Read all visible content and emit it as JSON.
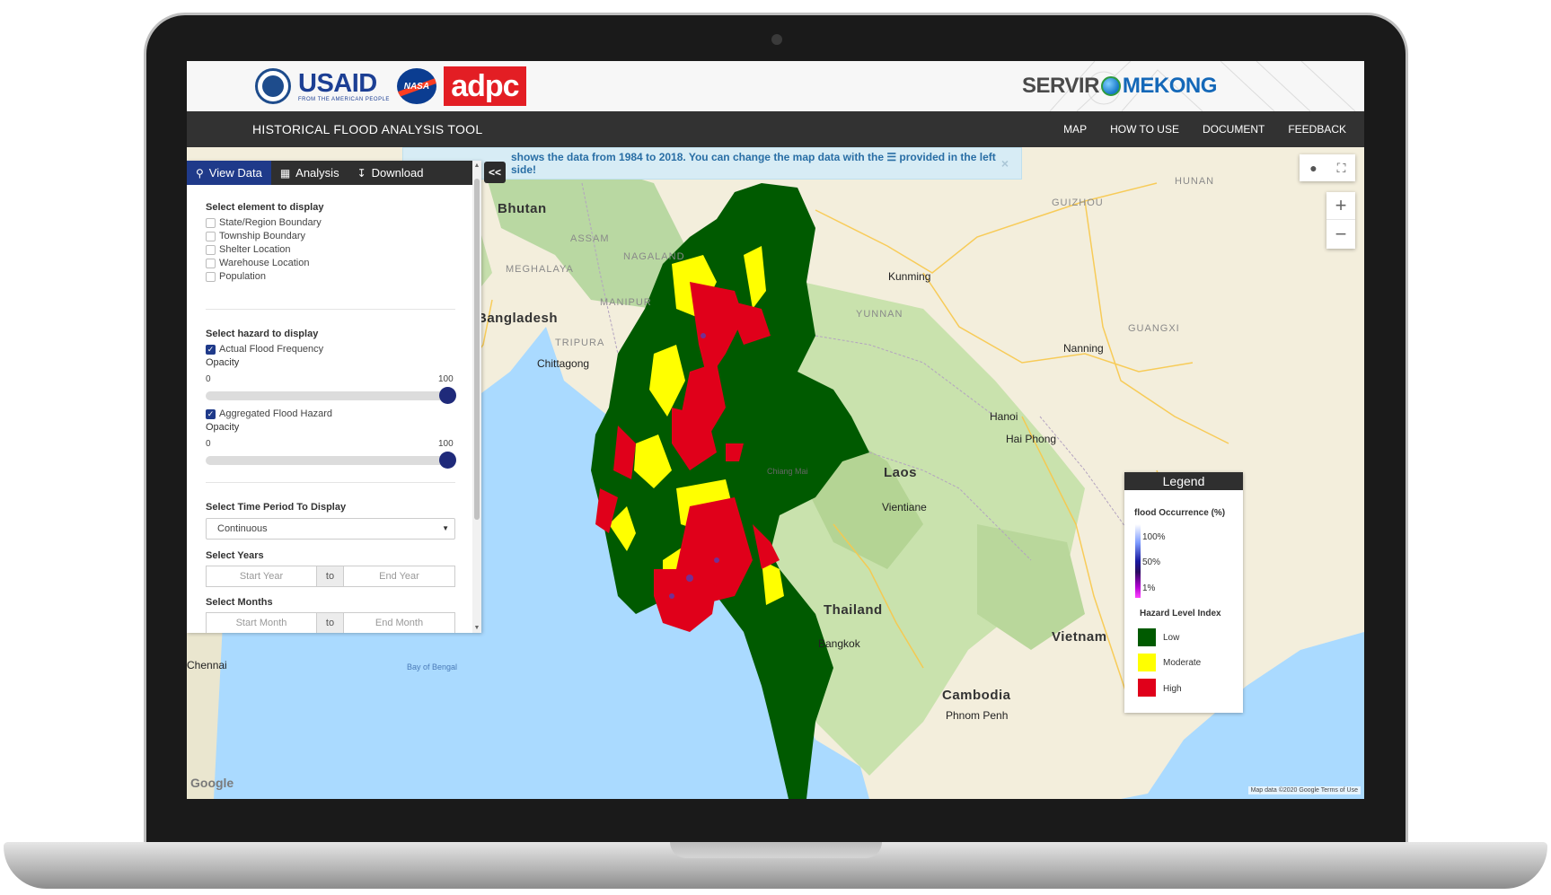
{
  "header": {
    "usaid_word": "USAID",
    "usaid_sub": "FROM THE AMERICAN PEOPLE",
    "nasa_word": "NASA",
    "adpc_word": "adpc",
    "servir_a": "SERVIR",
    "servir_b": "MEKONG"
  },
  "nav": {
    "title": "HISTORICAL FLOOD ANALYSIS TOOL",
    "links": [
      "MAP",
      "HOW TO USE",
      "DOCUMENT",
      "FEEDBACK"
    ]
  },
  "banner": {
    "text": "shows the data from 1984 to 2018. You can change the map data with the ☰ provided in the left side!",
    "close": "×"
  },
  "collapse_label": "<<",
  "panel": {
    "tabs": [
      {
        "icon": "search-icon",
        "label": "View Data",
        "active": true
      },
      {
        "icon": "map-icon",
        "label": "Analysis",
        "active": false
      },
      {
        "icon": "download-icon",
        "label": "Download",
        "active": false
      }
    ],
    "elements_title": "Select element to display",
    "elements": [
      "State/Region Boundary",
      "Township Boundary",
      "Shelter Location",
      "Warehouse Location",
      "Population"
    ],
    "hazard_title": "Select hazard to display",
    "hazards": [
      {
        "label": "Actual Flood Frequency",
        "checked": true,
        "opacity_label": "Opacity",
        "min": "0",
        "max": "100",
        "value": 100
      },
      {
        "label": "Aggregated Flood Hazard",
        "checked": true,
        "opacity_label": "Opacity",
        "min": "0",
        "max": "100",
        "value": 100
      }
    ],
    "period_title": "Select Time Period To Display",
    "period_value": "Continuous",
    "years_title": "Select Years",
    "start_year_placeholder": "Start Year",
    "to_label": "to",
    "end_year_placeholder": "End Year",
    "months_title": "Select Months",
    "start_month_placeholder": "Start Month",
    "end_month_placeholder": "End Month"
  },
  "legend": {
    "title": "Legend",
    "occurrence_title": "flood Occurrence (%)",
    "ramp_labels": [
      "100%",
      "50%",
      "1%"
    ],
    "hazard_title": "Hazard Level Index",
    "levels": [
      {
        "label": "Low",
        "color": "#005a00"
      },
      {
        "label": "Moderate",
        "color": "#ffff00"
      },
      {
        "label": "High",
        "color": "#e0001a"
      }
    ]
  },
  "map": {
    "countries": [
      "Bhutan",
      "Bangladesh",
      "Laos",
      "Thailand",
      "Cambodia",
      "Vietnam"
    ],
    "cities": [
      "Chittagong",
      "Kunming",
      "Nanning",
      "Hanoi",
      "Hai Phong",
      "Vientiane",
      "Bangkok",
      "Chennai",
      "Phnom Penh",
      "Chiang Mai"
    ],
    "regions": [
      "ASSAM",
      "NAGALAND",
      "MEGHALAYA",
      "MANIPUR",
      "TRIPURA",
      "YUNNAN",
      "GUIZHOU",
      "GUANGXI",
      "HUNAN"
    ],
    "sea": "Bay of Bengal",
    "google": "Google",
    "attribution": "Map data ©2020 Google   Terms of Use"
  }
}
